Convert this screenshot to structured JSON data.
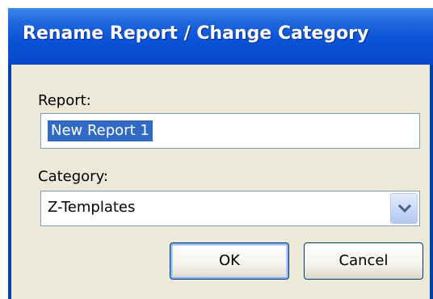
{
  "dialog": {
    "title": "Rename Report / Change Category"
  },
  "report": {
    "label": "Report:",
    "value": "New Report 1"
  },
  "category": {
    "label": "Category:",
    "selected": "Z-Templates"
  },
  "buttons": {
    "ok_label": "OK",
    "cancel_label": "Cancel"
  },
  "icons": {
    "dropdown": "chevron-down-icon"
  },
  "colors": {
    "title_bar": "#0a52d6",
    "dialog_face": "#ece9d8",
    "selection": "#316ac5"
  }
}
